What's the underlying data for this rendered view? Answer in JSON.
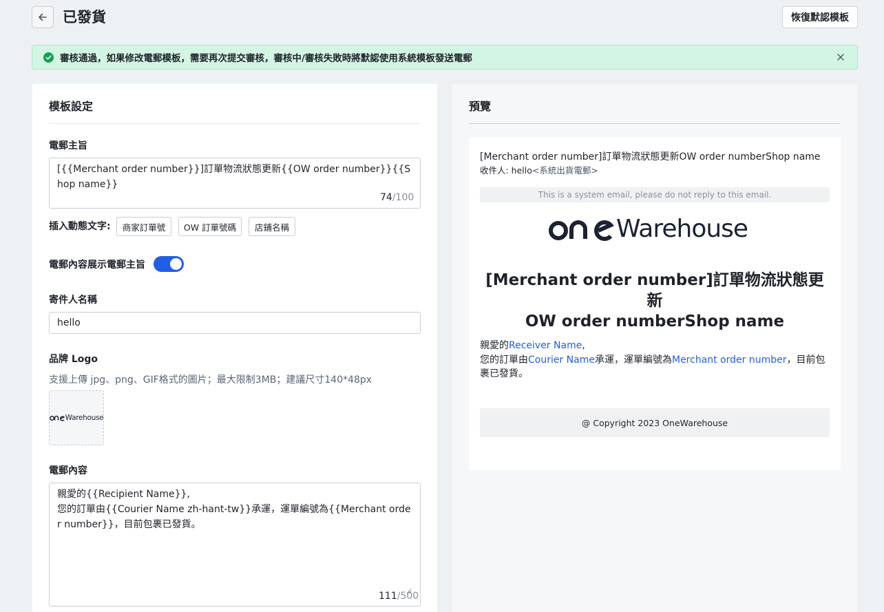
{
  "header": {
    "title": "已發貨",
    "restore_label": "恢復默認模板"
  },
  "alert": {
    "text": "審核通過，如果修改電郵模板，需要再次提交審核，審核中/審核失敗時將默認使用系統模板發送電郵"
  },
  "settings": {
    "title": "模板設定",
    "subject": {
      "label": "電郵主旨",
      "value": "[{{Merchant order number}}]訂單物流狀態更新{{OW order number}}{{Shop name}}",
      "count": "74",
      "max": "/100"
    },
    "dynamic": {
      "label": "插入動態文字:",
      "chips": [
        "商家訂單號",
        "OW 訂單號碼",
        "店鋪名稱"
      ]
    },
    "show_subject": {
      "label": "電郵內容展示電郵主旨",
      "enabled": true
    },
    "sender": {
      "label": "寄件人名稱",
      "value": "hello"
    },
    "brand_logo": {
      "label": "品牌 Logo",
      "hint": "支援上傳 jpg、png、GIF格式的圖片；最大限制3MB；建議尺寸140*48px",
      "logo_text": "Warehouse"
    },
    "content": {
      "label": "電郵內容",
      "value": "親愛的{{Recipient Name}},\n您的訂單由{{Courier Name zh-hant-tw}}承運，運單編號為{{Merchant order number}}，目前包裹已發貨。",
      "count": "111",
      "max": "/500"
    }
  },
  "preview": {
    "title": "預覽",
    "subject": "[Merchant order number]訂單物流狀態更新OW order numberShop name",
    "to_prefix": "收件人: hello",
    "to_addr": "<系統出貨電郵>",
    "system_notice": "This is a system email, please do not reply to this email.",
    "logo_text": "Warehouse",
    "heading_line1": "[Merchant order number]訂單物流狀態更新",
    "heading_line2": "OW order numberShop name",
    "greeting_prefix": "親愛的",
    "greeting_link": "Receiver Name",
    "greeting_suffix": ",",
    "body_prefix": "您的訂單由",
    "courier_link": "Courier Name",
    "body_mid": "承運，運單編號為",
    "order_link": "Merchant order number",
    "body_suffix": "，目前包裹已發貨。",
    "copyright": "@ Copyright 2023 OneWarehouse"
  },
  "colors": {
    "accent": "#1f5ee6",
    "success_bg": "#d3f5e4",
    "success_icon": "#12a150"
  },
  "icons": {
    "back": "arrow-left-icon",
    "success": "check-circle-icon",
    "close": "close-icon"
  }
}
